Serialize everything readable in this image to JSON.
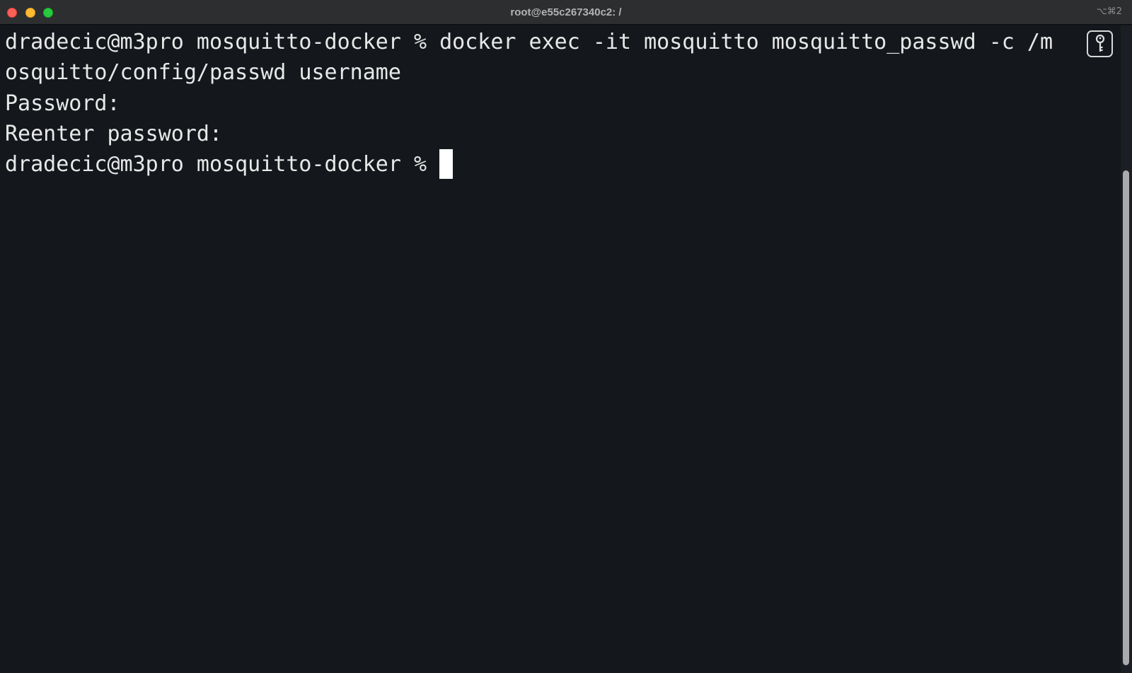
{
  "window": {
    "title": "root@e55c267340c2: /",
    "shortcut": "⌥⌘2"
  },
  "terminal": {
    "lines": [
      "dradecic@m3pro mosquitto-docker % docker exec -it mosquitto mosquitto_passwd -c /m",
      "osquitto/config/passwd username",
      "Password:",
      "Reenter password:",
      "dradecic@m3pro mosquitto-docker %"
    ]
  },
  "icons": {
    "badge": "key-icon"
  },
  "colors": {
    "background": "#14181c",
    "titlebar": "#2d2e30",
    "text": "#e8e8e8",
    "close": "#fe5f57",
    "minimize": "#febc2e",
    "zoom": "#28c840"
  }
}
